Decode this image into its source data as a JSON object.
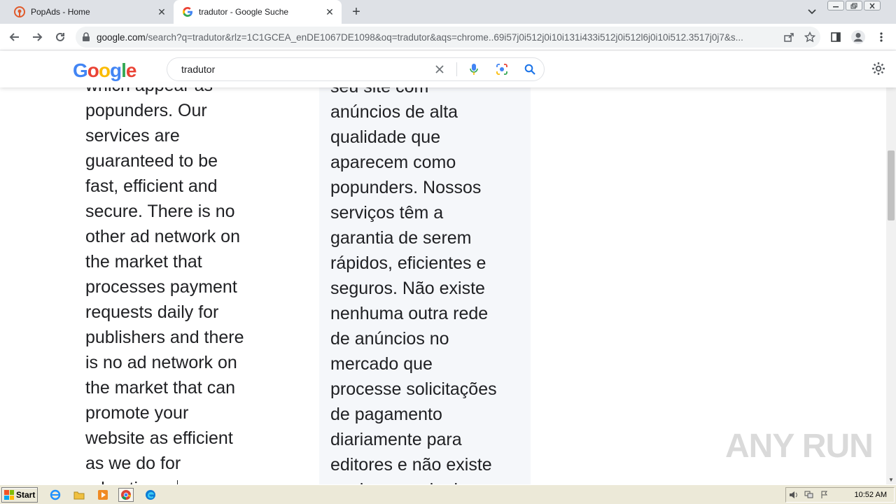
{
  "browser": {
    "tabs": [
      {
        "title": "PopAds - Home",
        "active": false
      },
      {
        "title": "tradutor - Google Suche",
        "active": true
      }
    ],
    "new_tab_symbol": "+",
    "close_symbol": "✕",
    "url_host": "google.com",
    "url_path": "/search?q=tradutor&rlz=1C1GCEA_enDE1067DE1098&oq=tradutor&aqs=chrome..69i57j0i512j0i10i131i433i512j0i512l6j0i10i512.3517j0j7&s..."
  },
  "google": {
    "logo_letters": [
      {
        "char": "G",
        "color": "#4285F4"
      },
      {
        "char": "o",
        "color": "#EA4335"
      },
      {
        "char": "o",
        "color": "#FBBC05"
      },
      {
        "char": "g",
        "color": "#4285F4"
      },
      {
        "char": "l",
        "color": "#34A853"
      },
      {
        "char": "e",
        "color": "#EA4335"
      }
    ],
    "search_value": "tradutor"
  },
  "content": {
    "english_lines": [
      "which appear as",
      "popunders. Our",
      "services are",
      "guaranteed to be",
      "fast, efficient and",
      "secure. There is no",
      "other ad network on",
      "the market that",
      "processes payment",
      "requests daily for",
      "publishers and there",
      "is no ad network on",
      "the market that can",
      "promote your",
      "website as efficient",
      "as we do for",
      "advertisers."
    ],
    "portuguese_lines": [
      "seu site com",
      "anúncios de alta",
      "qualidade que",
      "aparecem como",
      "popunders. Nossos",
      "serviços têm a",
      "garantia de serem",
      "rápidos, eficientes e",
      "seguros. Não existe",
      "nenhuma outra rede",
      "de anúncios no",
      "mercado que",
      "processe solicitações",
      "de pagamento",
      "diariamente para",
      "editores e não existe",
      "nenhuma rede de"
    ]
  },
  "watermark": "ANY RUN",
  "taskbar": {
    "start_label": "Start",
    "clock": "10:52 AM"
  },
  "colors": {
    "google_blue": "#1a73e8",
    "tab_strip": "#dee1e6",
    "translation_bg": "#f5f7fa"
  }
}
